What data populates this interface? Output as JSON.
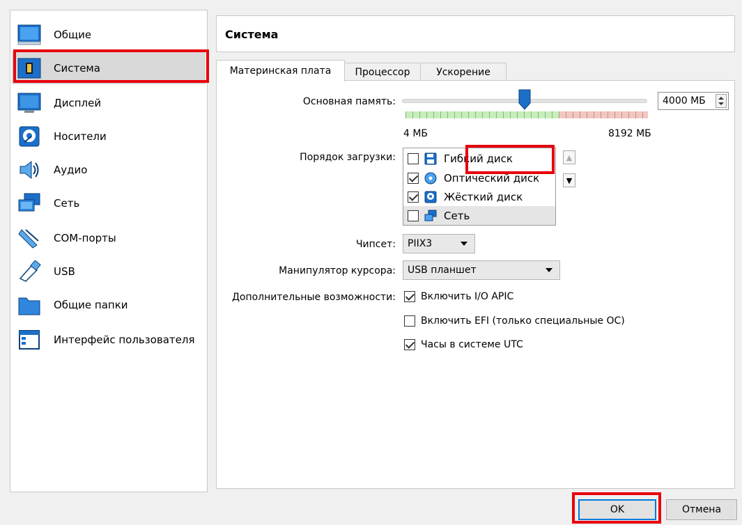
{
  "sidebar": {
    "items": [
      {
        "label": "Общие",
        "icon": "general-icon"
      },
      {
        "label": "Система",
        "icon": "system-icon"
      },
      {
        "label": "Дисплей",
        "icon": "display-icon"
      },
      {
        "label": "Носители",
        "icon": "storage-icon"
      },
      {
        "label": "Аудио",
        "icon": "audio-icon"
      },
      {
        "label": "Сеть",
        "icon": "network-icon"
      },
      {
        "label": "COM-порты",
        "icon": "serial-ports-icon"
      },
      {
        "label": "USB",
        "icon": "usb-icon"
      },
      {
        "label": "Общие папки",
        "icon": "shared-folders-icon"
      },
      {
        "label": "Интерфейс пользователя",
        "icon": "user-interface-icon"
      }
    ],
    "selected_index": 1
  },
  "header": {
    "title": "Система"
  },
  "tabs": [
    {
      "label": "Материнская плата",
      "active": true
    },
    {
      "label": "Процессор",
      "active": false
    },
    {
      "label": "Ускорение",
      "active": false
    }
  ],
  "memory": {
    "label": "Основная память:",
    "value": "4000 МБ",
    "min_label": "4 МБ",
    "max_label": "8192 МБ",
    "min": 4,
    "max": 8192,
    "current": 4000
  },
  "boot_order": {
    "label": "Порядок загрузки:",
    "items": [
      {
        "label": "Гибкий диск",
        "checked": false,
        "icon": "floppy-icon"
      },
      {
        "label": "Оптический диск",
        "checked": true,
        "icon": "optical-disc-icon"
      },
      {
        "label": "Жёсткий диск",
        "checked": true,
        "icon": "hard-disk-icon"
      },
      {
        "label": "Сеть",
        "checked": false,
        "icon": "network-icon"
      }
    ]
  },
  "chipset": {
    "label": "Чипсет:",
    "value": "PIIX3"
  },
  "pointing": {
    "label": "Манипулятор курсора:",
    "value": "USB планшет"
  },
  "features": {
    "label": "Дополнительные возможности:",
    "options": [
      {
        "label": "Включить I/O APIC",
        "checked": true
      },
      {
        "label": "Включить EFI (только специальные ОС)",
        "checked": false
      },
      {
        "label": "Часы в системе UTC",
        "checked": true
      }
    ]
  },
  "buttons": {
    "ok": "OK",
    "cancel": "Отмена"
  },
  "colors": {
    "highlight": "#e8000d",
    "accent": "#0078d7",
    "selection": "#d9d9d9"
  }
}
